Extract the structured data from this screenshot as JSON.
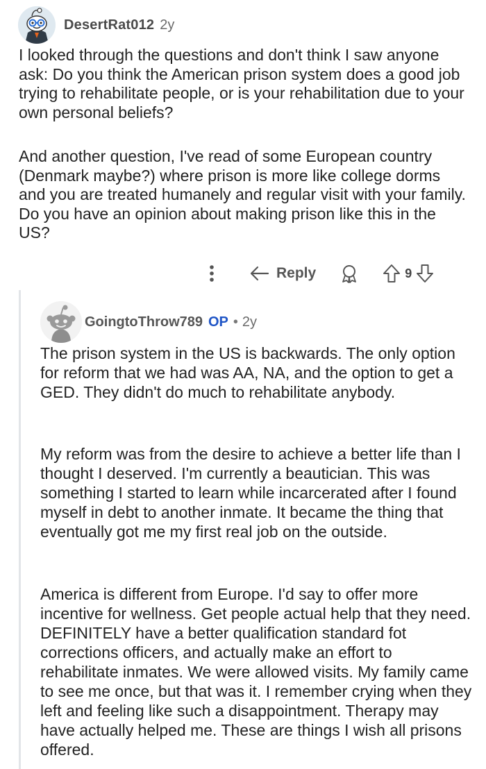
{
  "parent_comment": {
    "author": "DesertRat012",
    "age": "2y",
    "paragraphs": [
      "I looked through the questions and don't think I saw anyone ask: Do you think the American prison system does a good job trying to rehabilitate people, or is your rehabilitation due to your own personal beliefs?",
      "And another question, I've read of some European country (Denmark maybe?) where prison is more like college dorms and you are treated humanely and regular visit with your family. Do you have an opinion about making prison like this in the US?"
    ],
    "actions": {
      "more_icon": "more-vertical-icon",
      "reply_label": "Reply",
      "award_icon": "award-icon",
      "upvote_icon": "upvote-arrow-icon",
      "vote_count": "9",
      "downvote_icon": "downvote-arrow-icon"
    }
  },
  "reply_comment": {
    "author": "GoingtoThrow789",
    "op_badge": "OP",
    "separator": "•",
    "age": "2y",
    "paragraphs": [
      "The prison system in the US is backwards. The only option for reform that we had was AA, NA, and the option to get a GED. They didn't do much to rehabilitate anybody.",
      "My reform was from the desire to achieve a better life than I thought I deserved. I'm currently a beautician. This was something I started to learn while incarcerated after I found myself in debt to another inmate. It became the thing that eventually got me my first real job on the outside.",
      "America is different from Europe. I'd say to offer more incentive for wellness. Get people actual help that they need. DEFINITELY have a better qualification standard fot corrections officers, and actually make an effort to rehabilitate inmates. We were allowed visits. My family came to see me once, but that was it. I remember crying when they left and feeling like such a disappointment. Therapy may have actually helped me. These are things I wish all prisons offered."
    ]
  },
  "colors": {
    "text": "#222222",
    "meta": "#6b6b6b",
    "op_badge": "#1f55c6",
    "thread_line": "#e2e5e8"
  }
}
